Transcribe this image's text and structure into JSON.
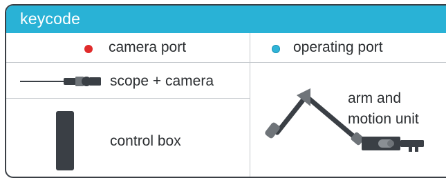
{
  "header": {
    "title": "keycode",
    "color": "#29b2d6"
  },
  "legend": {
    "camera_port": {
      "label": "camera port",
      "dot_color": "#e02b2b",
      "dot_icon": "red-dot-icon"
    },
    "operating_port": {
      "label": "operating port",
      "dot_color": "#2fb4d8",
      "dot_icon": "cyan-dot-icon"
    }
  },
  "components": {
    "scope_camera": {
      "label": "scope + camera",
      "icon": "scope-camera-icon"
    },
    "control_box": {
      "label": "control box",
      "icon": "control-box-icon"
    },
    "arm_motion_unit": {
      "label_line1": "arm and",
      "label_line2": "motion unit",
      "icon": "arm-motion-unit-icon"
    }
  },
  "colors": {
    "device_dark": "#3a3f45",
    "arm_joint": "#6f7479",
    "divider": "#c4c8cc",
    "text": "#2b2e31"
  }
}
